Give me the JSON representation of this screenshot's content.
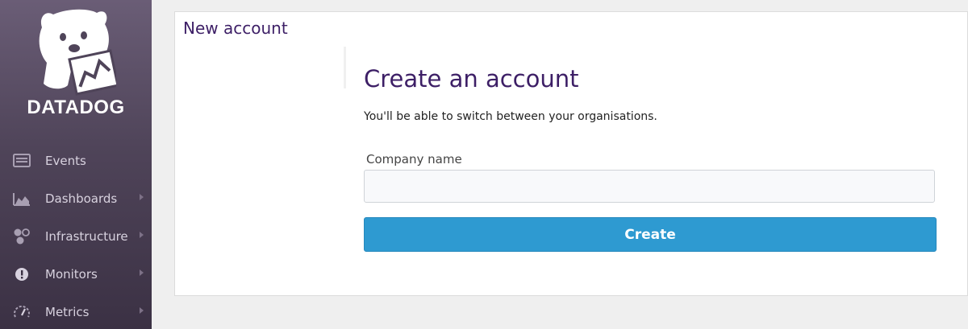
{
  "brand": {
    "name": "DATADOG",
    "logo_icon": "datadog-dog-logo-icon"
  },
  "sidebar": {
    "items": [
      {
        "label": "Events",
        "icon": "events-list-icon",
        "has_submenu": false
      },
      {
        "label": "Dashboards",
        "icon": "area-chart-icon",
        "has_submenu": true
      },
      {
        "label": "Infrastructure",
        "icon": "hexagons-icon",
        "has_submenu": true
      },
      {
        "label": "Monitors",
        "icon": "alert-circle-icon",
        "has_submenu": true
      },
      {
        "label": "Metrics",
        "icon": "gauge-icon",
        "has_submenu": true
      }
    ]
  },
  "page": {
    "title": "New account",
    "heading": "Create an account",
    "subtext": "You'll be able to switch between your organisations.",
    "company_field": {
      "label": "Company name",
      "value": "",
      "placeholder": ""
    },
    "create_button": "Create"
  },
  "colors": {
    "accent": "#2e9ad1",
    "heading": "#3d1f66",
    "sidebar": "#4f4459"
  }
}
